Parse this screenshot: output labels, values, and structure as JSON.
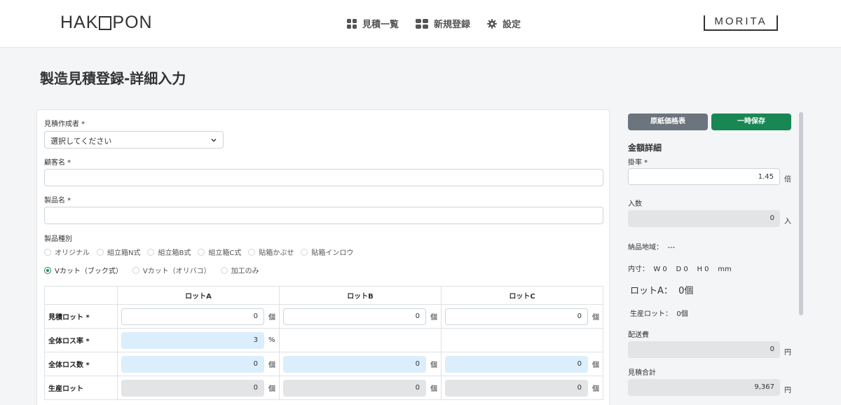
{
  "header": {
    "logo_left_pre": "HAK",
    "logo_left_post": "PON",
    "logo_right": "MORITA",
    "nav": [
      {
        "label": "見積一覧",
        "icon": "grid-icon"
      },
      {
        "label": "新規登録",
        "icon": "blocks-icon"
      },
      {
        "label": "設定",
        "icon": "gear-icon"
      }
    ]
  },
  "page": {
    "title": "製造見積登録-詳細入力"
  },
  "form": {
    "creator_label": "見積作成者 *",
    "creator_select": "選択してください",
    "customer_label": "顧客名 *",
    "customer_value": "",
    "product_label": "製品名 *",
    "product_value": "",
    "type_label": "製品種別",
    "types": [
      "オリジナル",
      "組立箱N式",
      "組立箱B式",
      "組立箱C式",
      "貼箱かぶせ",
      "貼箱インロウ"
    ],
    "cut_options": [
      "Vカット（ブック式）",
      "Vカット（オリバコ）",
      "加工のみ"
    ],
    "cut_selected": "Vカット（ブック式）"
  },
  "lots_table": {
    "headers": [
      "",
      "ロットA",
      "ロットB",
      "ロットC"
    ],
    "rows": [
      {
        "label": "見積ロット *",
        "cells": [
          {
            "value": "0",
            "unit": "個"
          },
          {
            "value": "0",
            "unit": "個"
          },
          {
            "value": "0",
            "unit": "個"
          }
        ]
      },
      {
        "label": "全体ロス率 *",
        "cells": [
          {
            "value": "3",
            "unit": "%"
          },
          null,
          null
        ]
      },
      {
        "label": "全体ロス数 *",
        "cells": [
          {
            "value": "0",
            "unit": "個"
          },
          {
            "value": "0",
            "unit": "個"
          },
          {
            "value": "0",
            "unit": "個"
          }
        ]
      },
      {
        "label": "生産ロット",
        "cells": [
          {
            "value": "0",
            "unit": "個"
          },
          {
            "value": "0",
            "unit": "個"
          },
          {
            "value": "0",
            "unit": "個"
          }
        ]
      }
    ]
  },
  "side": {
    "btn_paper_price": "原紙価格表",
    "btn_temp_save": "一時保存",
    "title": "金額詳細",
    "rate_label": "掛率 *",
    "rate_value": "1.45",
    "rate_unit": "倍",
    "count_label": "入数",
    "count_value": "0",
    "count_unit": "入",
    "region": "納品地域：  ---",
    "inner_size": "内寸：  W 0    D 0    H 0    mm",
    "lot_a": "ロットA：  0個",
    "prod_lot": "生産ロット：  0個",
    "shipping_label": "配送費",
    "shipping_value": "0",
    "shipping_unit": "円",
    "total_label": "見積合計",
    "total_value": "9,367",
    "total_unit": "円"
  }
}
